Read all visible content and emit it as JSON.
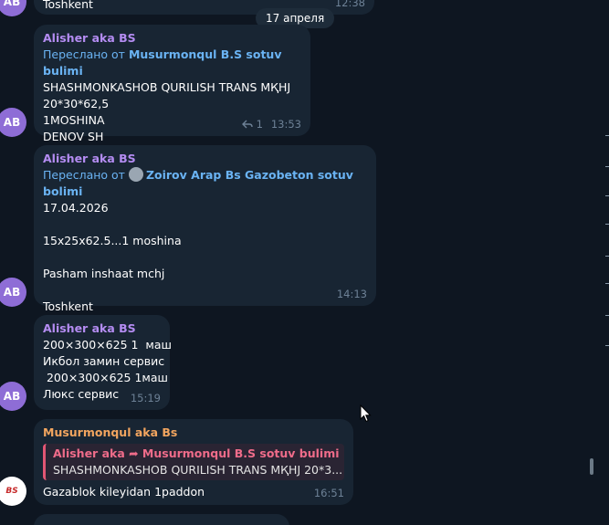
{
  "top_partial": {
    "text": "Toshkent",
    "time": "12:38",
    "avatar": "AB"
  },
  "date_separator": "17 апреля",
  "messages": [
    {
      "avatar": "AB",
      "sender": "Alisher aka BS",
      "forward_prefix": "Переслано от",
      "forward_from": "Musurmonqul B.S sotuv bulimi",
      "lines": [
        "SHASHMONKASHOB QURILISH TRANS MҚHJ",
        "20*30*62,5",
        "1MOSHINA",
        "DENOV SH"
      ],
      "replies": "1",
      "time": "13:53"
    },
    {
      "avatar": "AB",
      "sender": "Alisher aka BS",
      "forward_prefix": "Переслано от",
      "forward_from": "Zoirov Arap Bs Gazobeton sotuv bolimi",
      "lines": [
        "17.04.2026",
        "",
        "15x25x62.5...1 moshina",
        "",
        "Pasham inshaat mchj",
        "",
        "Toshkent"
      ],
      "time": "14:13"
    },
    {
      "avatar": "AB",
      "sender": "Alisher aka BS",
      "lines": [
        "200×300×625 1  маш",
        "Икбол замин сервис",
        " 200×300×625 1маш",
        "Люкс сервис"
      ],
      "time": "15:19"
    },
    {
      "avatar": "BS",
      "sender": "Musurmonqul aka Bs",
      "quote_title": "Alisher aka ➦ Musurmonqul B.S sotuv bulimi",
      "quote_text": "SHASHMONKASHOB QURILISH TRANS MҚHJ  20*3...",
      "lines": [
        "Gazablok kileyidan 1paddon"
      ],
      "time": "16:51"
    }
  ]
}
